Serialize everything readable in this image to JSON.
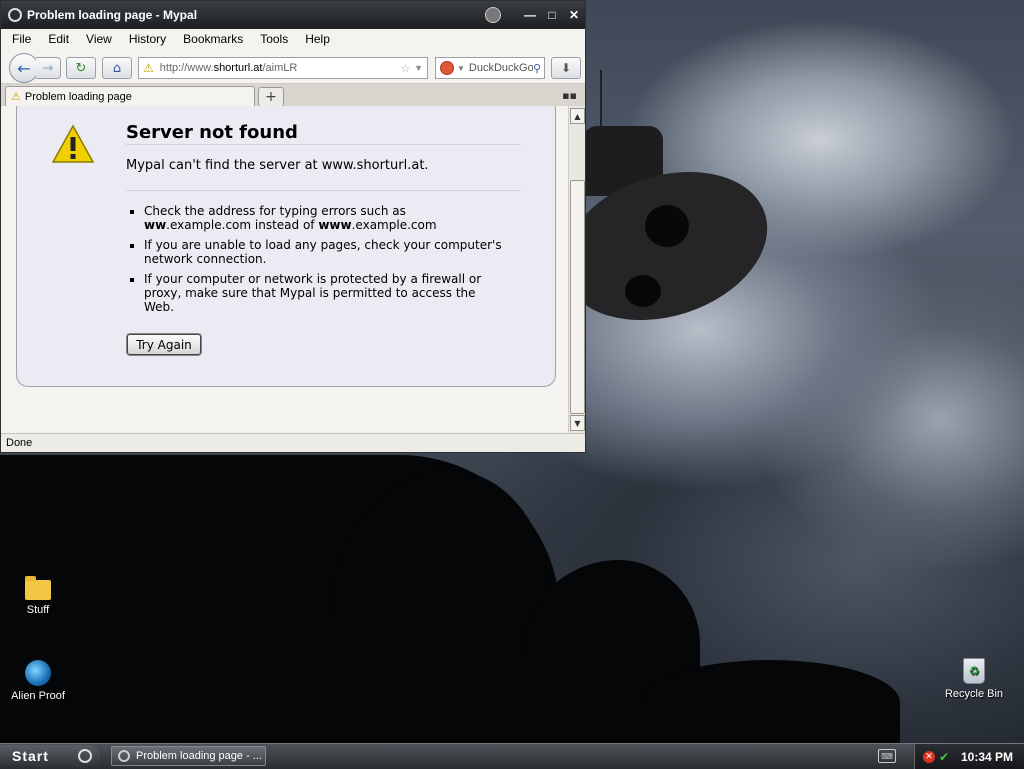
{
  "window": {
    "title": "Problem loading page - Mypal"
  },
  "menu": [
    "File",
    "Edit",
    "View",
    "History",
    "Bookmarks",
    "Tools",
    "Help"
  ],
  "navbar": {
    "url_prefix": "http://www.",
    "url_host": "shorturl.at",
    "url_path": "/aimLR",
    "search_text": "DuckDuckGo"
  },
  "tab": {
    "label": "Problem loading page",
    "new_tab": "+"
  },
  "error": {
    "title": "Server not found",
    "description": "Mypal can't find the server at www.shorturl.at.",
    "bullets": [
      {
        "a": "Check the address for typing errors such as ",
        "b": "ww",
        "c": ".example.com instead of ",
        "d": "www",
        "e": ".example.com"
      },
      {
        "text": "If you are unable to load any pages, check your computer's network connection."
      },
      {
        "text": "If your computer or network is protected by a firewall or proxy, make sure that Mypal is permitted to access the Web."
      }
    ],
    "button": "Try Again"
  },
  "status": "Done",
  "desktop": {
    "icons": [
      {
        "label": "Stuff"
      },
      {
        "label": "Alien Proof"
      },
      {
        "label": "Recycle Bin"
      }
    ]
  },
  "taskbar": {
    "start_label": "Start",
    "task_label": "Problem loading page - ...",
    "clock": "10:34 PM"
  }
}
